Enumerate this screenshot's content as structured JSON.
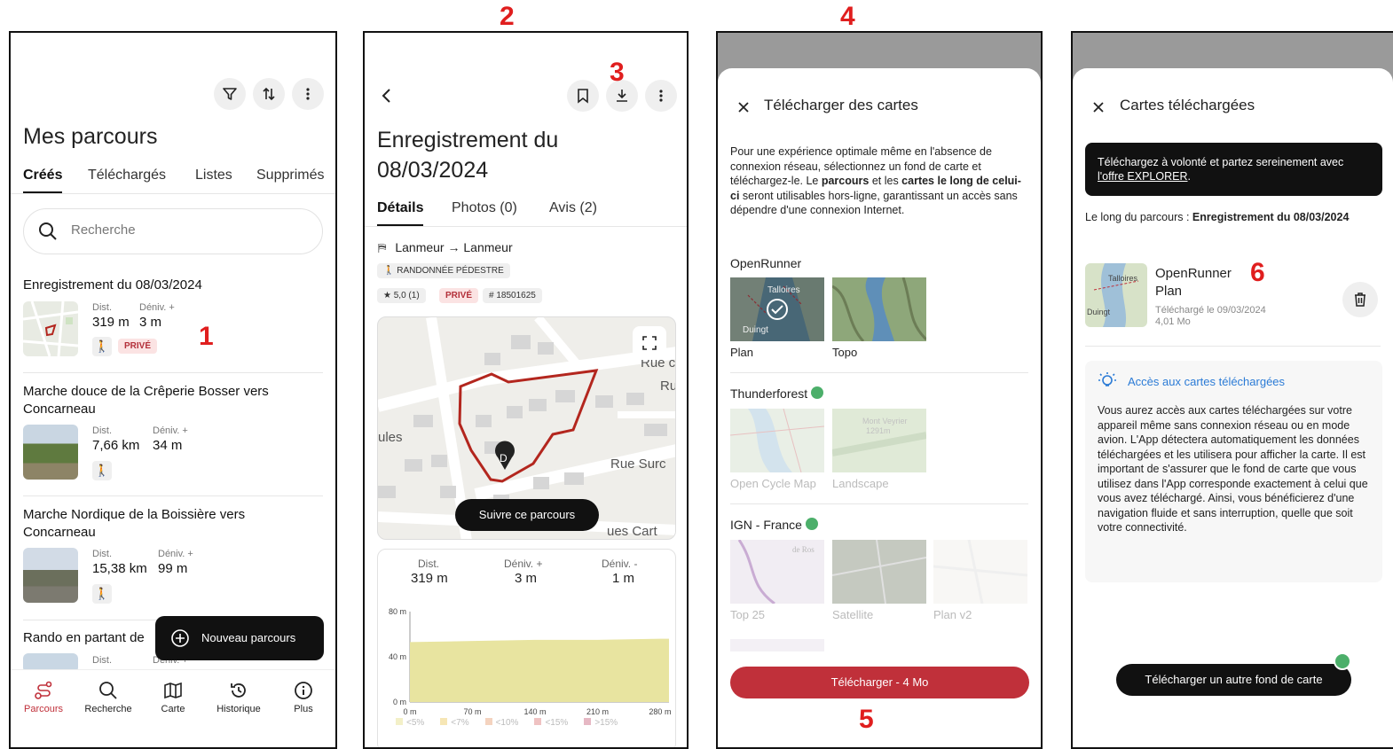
{
  "annotations": [
    "1",
    "2",
    "3",
    "4",
    "5",
    "6"
  ],
  "colors": {
    "accent": "#c0303a",
    "track": "#b3261e",
    "dark": "#111111",
    "elev_fill": "#e8e4a0"
  },
  "screen1": {
    "title": "Mes parcours",
    "tabs": [
      "Créés",
      "Téléchargés",
      "Listes",
      "Supprimés"
    ],
    "search_placeholder": "Recherche",
    "items": [
      {
        "title": "Enregistrement du 08/03/2024",
        "dist_label": "Dist.",
        "dist": "319 m",
        "deniv_label": "Déniv. +",
        "deniv": "3 m",
        "private": "PRIVÉ"
      },
      {
        "title": "Marche douce de la Crêperie Bosser vers Concarneau",
        "dist_label": "Dist.",
        "dist": "7,66 km",
        "deniv_label": "Déniv. +",
        "deniv": "34 m"
      },
      {
        "title": "Marche Nordique de la Boissière vers Concarneau",
        "dist_label": "Dist.",
        "dist": "15,38 km",
        "deniv_label": "Déniv. +",
        "deniv": "99 m"
      },
      {
        "title": "Rando en partant de",
        "dist_label": "Dist.",
        "deniv_label": "Déniv. +"
      }
    ],
    "new_button": "Nouveau parcours",
    "nav": [
      "Parcours",
      "Recherche",
      "Carte",
      "Historique",
      "Plus"
    ]
  },
  "screen2": {
    "title": "Enregistrement du 08/03/2024",
    "tabs": [
      "Détails",
      "Photos (0)",
      "Avis (2)"
    ],
    "route": "Lanmeur → Lanmeur",
    "activity": "RANDONNÉE PÉDESTRE",
    "rating": "5,0 (1)",
    "private": "PRIVÉ",
    "id": "# 18501625",
    "map_labels": [
      "ules",
      "Rue Surc",
      "ues Cart",
      "Rue c",
      "Ru"
    ],
    "start_marker": "D",
    "follow_button": "Suivre ce parcours",
    "stats": [
      {
        "label": "Dist.",
        "value": "319 m"
      },
      {
        "label": "Déniv. +",
        "value": "3 m"
      },
      {
        "label": "Déniv. -",
        "value": "1 m"
      }
    ],
    "chart_data": {
      "type": "area",
      "x": [
        0,
        70,
        140,
        210,
        280
      ],
      "x_tick_labels": [
        "0 m",
        "70 m",
        "140 m",
        "210 m",
        "280 m"
      ],
      "y_tick_labels": [
        "80 m",
        "40 m",
        "0 m"
      ],
      "ylim": [
        0,
        80
      ],
      "series": [
        {
          "values": [
            53,
            54,
            55,
            55,
            56
          ]
        }
      ]
    },
    "slope_legend": [
      "<5%",
      "<7%",
      "<10%",
      "<15%",
      ">15%"
    ],
    "slope_colors": [
      "#f3f0c8",
      "#f6e6b5",
      "#f4d3bf",
      "#efc2c2",
      "#e6b8c4"
    ]
  },
  "screen3": {
    "title": "Télécharger des cartes",
    "intro_1": "Pour une expérience optimale même en l'absence de connexion réseau, sélectionnez un fond de carte et téléchargez-le.  Le ",
    "intro_b1": "parcours",
    "intro_2": " et les ",
    "intro_b2": "cartes le long de celui-ci",
    "intro_3": " seront utilisables hors-ligne, garantissant un accès sans dépendre d'une connexion Internet.",
    "groups": [
      {
        "name": "OpenRunner",
        "maps": [
          "Plan",
          "Topo"
        ]
      },
      {
        "name": "Thunderforest",
        "maps": [
          "Open Cycle Map",
          "Landscape"
        ]
      },
      {
        "name": "IGN - France",
        "maps": [
          "Top 25",
          "Satellite",
          "Plan v2"
        ]
      }
    ],
    "thumb_labels": [
      "Talloires",
      "Duingt",
      "Mont Veyrier",
      "1291m",
      "de Ros"
    ],
    "download_button": "Télécharger - 4 Mo"
  },
  "screen4": {
    "title": "Cartes téléchargées",
    "banner_1": "Téléchargez à volonté et partez sereinement avec ",
    "banner_link": "l'offre EXPLORER",
    "banner_end": ".",
    "route_label": "Le long du parcours : ",
    "route_name": "Enregistrement du 08/03/2024",
    "map_name": "OpenRunner",
    "map_type": "Plan",
    "downloaded": "Téléchargé le 09/03/2024",
    "size": "4,01 Mo",
    "thumb_labels": [
      "Talloires",
      "Duingt"
    ],
    "info_title": "Accès aux cartes téléchargées",
    "info_text": "Vous aurez accès aux cartes téléchargées sur votre appareil même sans connexion réseau ou en mode avion. L'App détectera automatiquement les données téléchargées et les utilisera pour afficher la carte. Il est important de s'assurer que le fond de carte que vous utilisez dans l'App corresponde exactement à celui que vous avez téléchargé. Ainsi, vous bénéficierez d'une navigation fluide et sans interruption, quelle que soit votre connectivité.",
    "other_button": "Télécharger un autre fond de carte"
  }
}
